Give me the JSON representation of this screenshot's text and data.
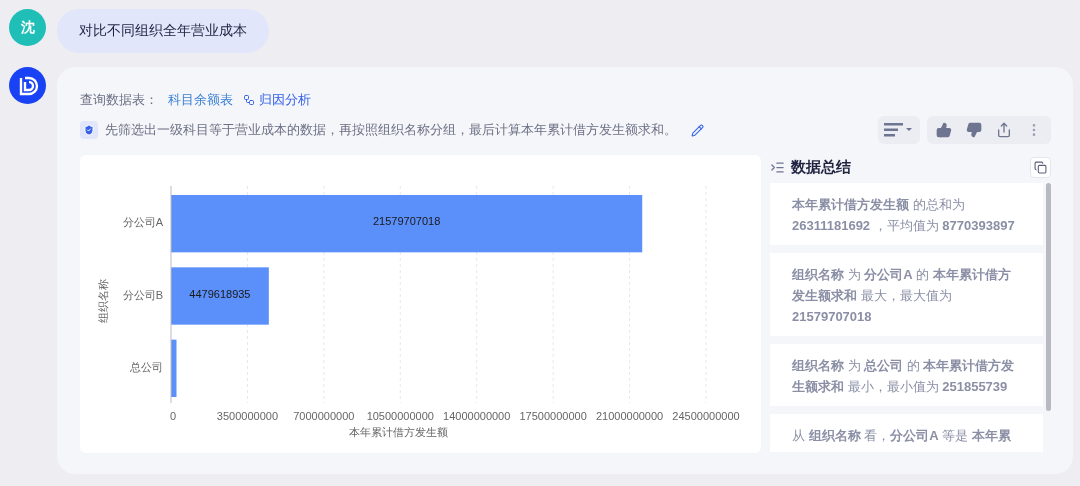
{
  "user_message": {
    "avatar": "沈",
    "text": "对比不同组织全年营业成本"
  },
  "answer": {
    "source_label": "查询数据表：",
    "source_table": "科目余额表",
    "attribution_link": "归因分析",
    "description": "先筛选出一级科目等于营业成本的数据，再按照组织名称分组，最后计算本年累计借方发生额求和。",
    "chart_data": {
      "type": "bar",
      "orientation": "horizontal",
      "xlabel": "本年累计借方发生额",
      "ylabel": "组织名称",
      "categories": [
        "分公司A",
        "分公司B",
        "总公司"
      ],
      "grid": true,
      "series": [
        {
          "color": "#5b8ff9",
          "values": [
            21579707018,
            4479618935,
            251855739
          ]
        }
      ],
      "xlim": [
        0,
        24500000000
      ],
      "xticks": [
        0,
        3500000000,
        7000000000,
        10500000000,
        14000000000,
        17500000000,
        21000000000,
        24500000000
      ],
      "value_labels": [
        "21579707018",
        "4479618935",
        null
      ]
    },
    "summary": {
      "title": "数据总结",
      "items": [
        "**本年累计借方发生额** 的总和为 **26311181692** ，平均值为 **8770393897**",
        "**组织名称** 为 **分公司A** 的 **本年累计借方发生额求和** 最大，最大值为 **21579707018**",
        "**组织名称** 为 **总公司** 的 **本年累计借方发生额求和** 最小，最小值为 **251855739**",
        "从 **组织名称** 看，**分公司A** 等是 **本年累**"
      ]
    }
  }
}
